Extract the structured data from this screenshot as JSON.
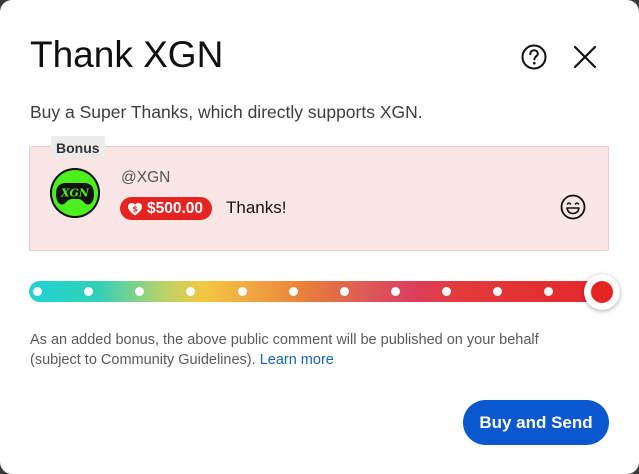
{
  "dialog": {
    "title": "Thank XGN",
    "subtitle": "Buy a Super Thanks, which directly supports XGN."
  },
  "icons": {
    "help": "help-circle-icon",
    "close": "close-icon",
    "amount": "super-thanks-dollar-heart-icon",
    "emoji": "smiley-emoji-icon"
  },
  "preview": {
    "bonus_label": "Bonus",
    "avatar_text": "XGN",
    "handle": "@XGN",
    "amount": "$500.00",
    "comment": "Thanks!"
  },
  "slider": {
    "selected_step": 12,
    "total_steps": 12
  },
  "note": {
    "text": "As an added bonus, the above public comment will be published on your behalf (subject to Community Guidelines).",
    "link": "Learn more"
  },
  "actions": {
    "buy_label": "Buy and Send"
  },
  "colors": {
    "amount_pill": "#e52421",
    "primary_button": "#0b57d0",
    "preview_bg": "#fbe6e6",
    "link": "#1565c0",
    "avatar_green": "#4cf01f"
  }
}
